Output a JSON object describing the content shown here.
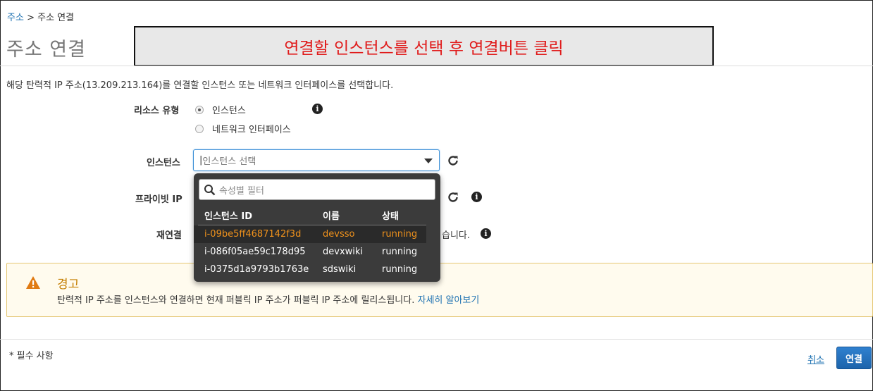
{
  "breadcrumb": {
    "parent": "주소",
    "separator": ">",
    "current": "주소 연결"
  },
  "page_title": "주소 연결",
  "annotation": "연결할 인스턴스를 선택 후 연결버튼 클릭",
  "description": "해당 탄력적 IP 주소(13.209.213.164)를 연결할 인스턴스 또는 네트워크 인터페이스를 선택합니다.",
  "resource_type": {
    "label": "리소스 유형",
    "options": [
      {
        "label": "인스턴스",
        "checked": true
      },
      {
        "label": "네트워크 인터페이스",
        "checked": false
      }
    ]
  },
  "instance": {
    "label": "인스턴스",
    "placeholder": "인스턴스 선택"
  },
  "private_ip": {
    "label": "프라이빗 IP"
  },
  "reassociation": {
    "label": "재연결",
    "trailing_text": "습니다."
  },
  "dropdown": {
    "filter_placeholder": "속성별 필터",
    "columns": [
      "인스턴스 ID",
      "이름",
      "상태"
    ],
    "rows": [
      {
        "id": "i-09be5ff4687142f3d",
        "name": "devsso",
        "state": "running",
        "highlighted": true
      },
      {
        "id": "i-086f05ae59c178d95",
        "name": "devxwiki",
        "state": "running",
        "highlighted": false
      },
      {
        "id": "i-0375d1a9793b1763e",
        "name": "sdswiki",
        "state": "running",
        "highlighted": false
      }
    ]
  },
  "warning": {
    "title": "경고",
    "body": "탄력적 IP 주소를 인스턴스와 연결하면 현재 퍼블릭 IP 주소가 퍼블릭 IP 주소에 릴리스됩니다.",
    "link": "자세히 알아보기"
  },
  "footer": {
    "required_note": "* 필수 사항",
    "cancel": "취소",
    "connect": "연결"
  },
  "colors": {
    "link": "#1a6fb0",
    "primary_button": "#1d64ab",
    "annotation_text": "#e01b1b",
    "highlight_row_text": "#f0921c",
    "warning_title": "#c47e00"
  }
}
